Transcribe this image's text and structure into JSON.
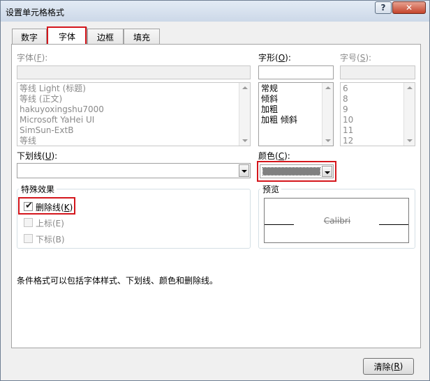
{
  "window": {
    "title": "设置单元格格式",
    "help_label": "?",
    "close_label": "✕"
  },
  "tabs": [
    {
      "label": "数字"
    },
    {
      "label": "字体"
    },
    {
      "label": "边框"
    },
    {
      "label": "填充"
    }
  ],
  "font": {
    "label_prefix": "字体(",
    "label_key": "F",
    "label_suffix": "):",
    "value": "",
    "items": [
      "等线 Light (标题)",
      "等线 (正文)",
      "hakuyoxingshu7000",
      "Microsoft YaHei UI",
      "SimSun-ExtB",
      "等线"
    ]
  },
  "style": {
    "label_prefix": "字形(",
    "label_key": "O",
    "label_suffix": "):",
    "value": "",
    "items": [
      "常规",
      "倾斜",
      "加粗",
      "加粗 倾斜"
    ]
  },
  "size": {
    "label_prefix": "字号(",
    "label_key": "S",
    "label_suffix": "):",
    "value": "",
    "items": [
      "6",
      "8",
      "9",
      "10",
      "11",
      "12"
    ]
  },
  "underline": {
    "label_prefix": "下划线(",
    "label_key": "U",
    "label_suffix": "):",
    "value": ""
  },
  "color": {
    "label_prefix": "颜色(",
    "label_key": "C",
    "label_suffix": "):",
    "swatch": "#808080"
  },
  "effects": {
    "title": "特殊效果",
    "strikethrough": {
      "label_prefix": "删除线(",
      "label_key": "K",
      "label_suffix": ")",
      "checked": true
    },
    "superscript": {
      "label": "上标(E)",
      "checked": false
    },
    "subscript": {
      "label": "下标(B)",
      "checked": false
    }
  },
  "preview": {
    "title": "预览",
    "sample": "Calibri"
  },
  "note": "条件格式可以包括字体样式、下划线、颜色和删除线。",
  "clear_button": {
    "label_prefix": "清除(",
    "label_key": "R",
    "label_suffix": ")"
  },
  "colors": {
    "highlight": "#d4161c",
    "panel_border": "#a3a3a3"
  }
}
